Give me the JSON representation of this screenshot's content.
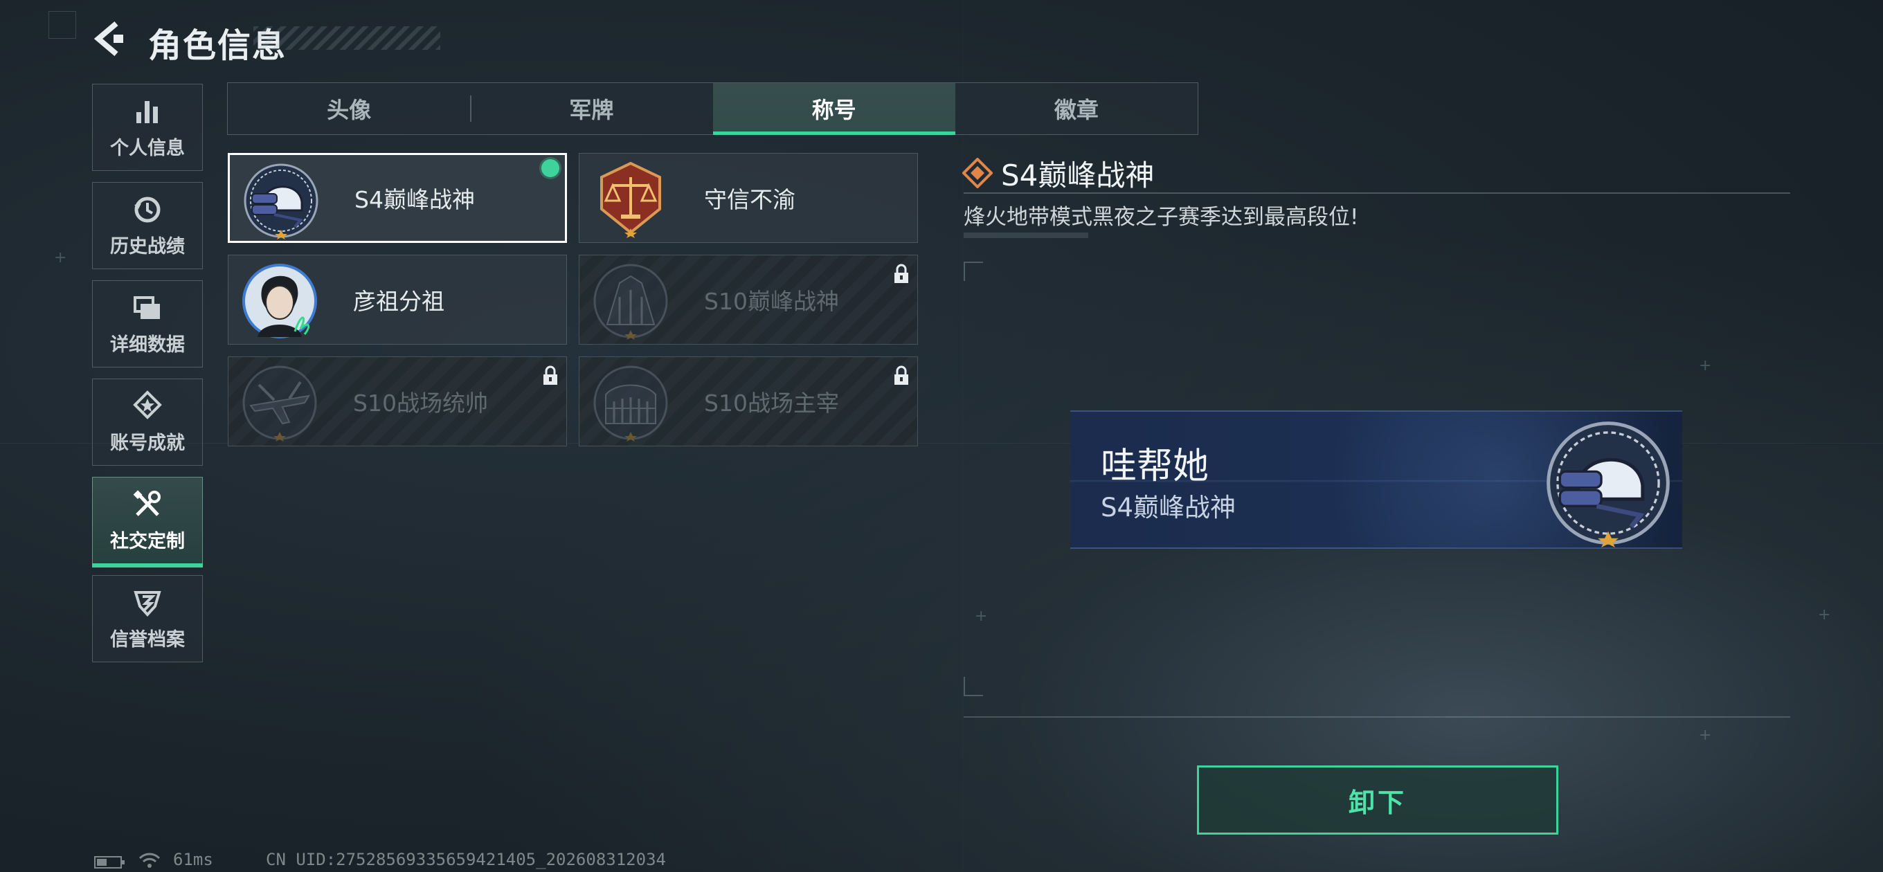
{
  "header": {
    "title": "角色信息"
  },
  "sidebar": {
    "items": [
      {
        "label": "个人信息",
        "icon": "bar-chart-icon",
        "active": false
      },
      {
        "label": "历史战绩",
        "icon": "history-icon",
        "active": false
      },
      {
        "label": "详细数据",
        "icon": "folders-icon",
        "active": false
      },
      {
        "label": "账号成就",
        "icon": "achievement-icon",
        "active": false
      },
      {
        "label": "社交定制",
        "icon": "tools-icon",
        "active": true
      },
      {
        "label": "信誉档案",
        "icon": "reputation-icon",
        "active": false
      }
    ]
  },
  "tabs": [
    {
      "label": "头像",
      "active": false
    },
    {
      "label": "军牌",
      "active": false
    },
    {
      "label": "称号",
      "active": true
    },
    {
      "label": "徽章",
      "active": false
    }
  ],
  "titles": [
    {
      "name": "S4巅峰战神",
      "emblem": "helmet-emblem-icon",
      "selected": true,
      "equipped": true,
      "locked": false
    },
    {
      "name": "守信不渝",
      "emblem": "scales-emblem-icon",
      "selected": false,
      "equipped": false,
      "locked": false
    },
    {
      "name": "彦祖分祖",
      "emblem": "portrait-emblem-icon",
      "selected": false,
      "equipped": false,
      "locked": false
    },
    {
      "name": "S10巅峰战神",
      "emblem": "tower-emblem-icon",
      "selected": false,
      "equipped": false,
      "locked": true
    },
    {
      "name": "S10战场统帅",
      "emblem": "aircraft-emblem-icon",
      "selected": false,
      "equipped": false,
      "locked": true
    },
    {
      "name": "S10战场主宰",
      "emblem": "colosseum-emblem-icon",
      "selected": false,
      "equipped": false,
      "locked": true
    }
  ],
  "detail": {
    "title": "S4巅峰战神",
    "description": "烽火地带模式黑夜之子赛季达到最高段位!"
  },
  "preview": {
    "player_name": "哇帮她",
    "title": "S4巅峰战神"
  },
  "actions": {
    "unequip_label": "卸下"
  },
  "status_bar": {
    "ping": "61ms",
    "uid": "CN UID:27528569335659421405_202608312034"
  },
  "colors": {
    "accent_green": "#3ed39a",
    "background": "#1b242b",
    "detail_icon": "#e0864a"
  }
}
